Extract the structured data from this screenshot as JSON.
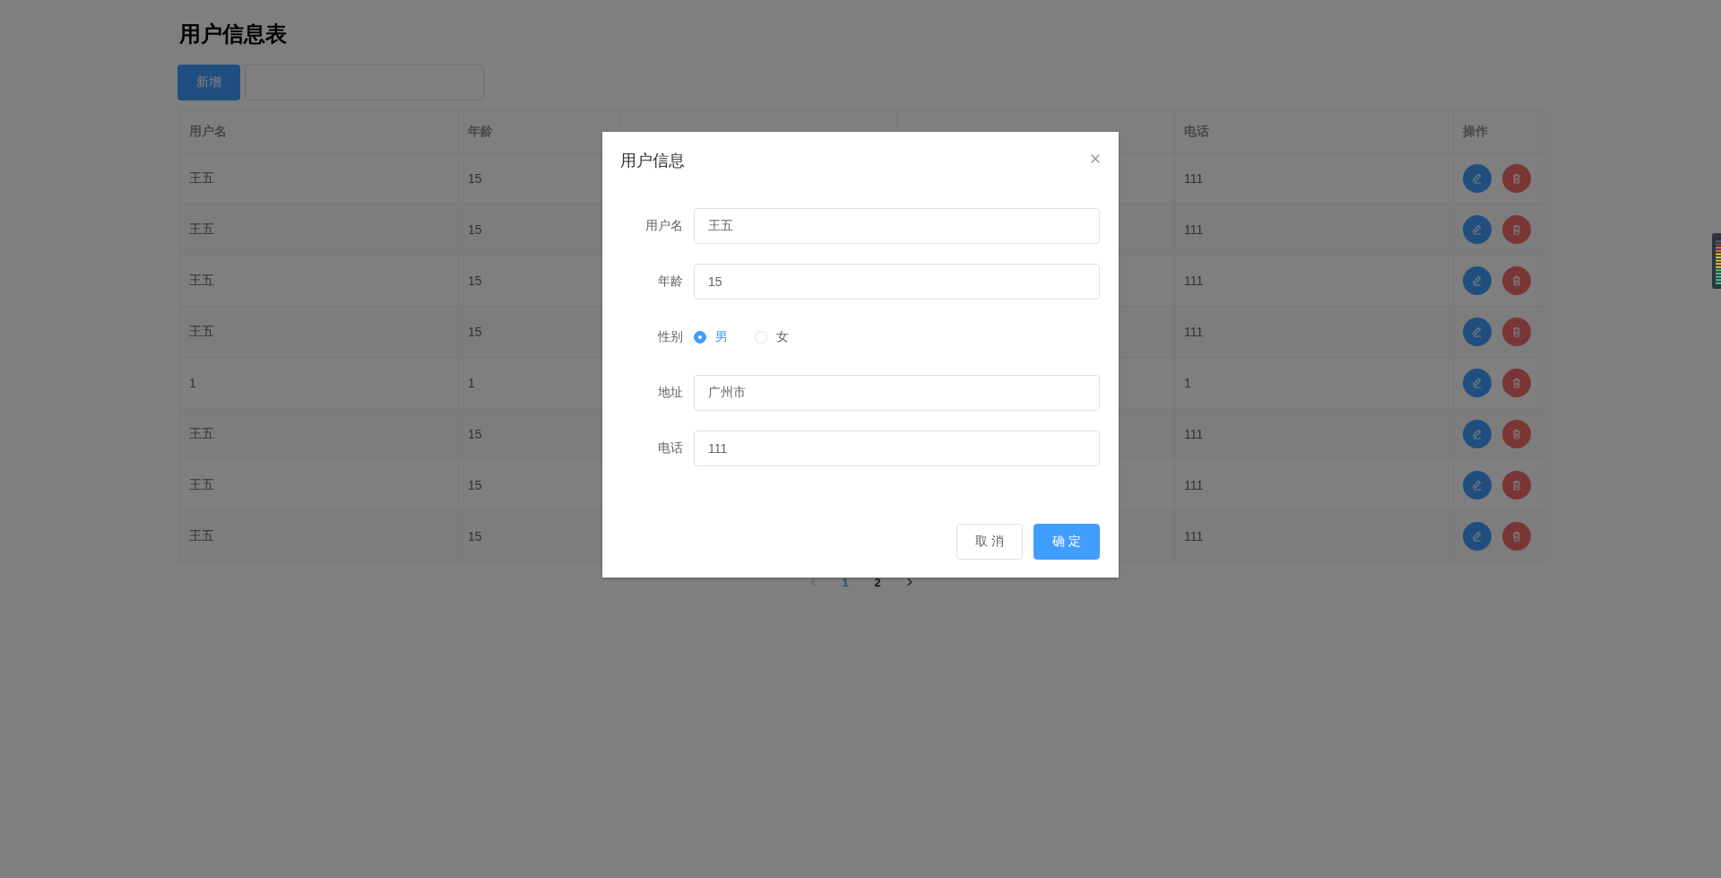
{
  "page_title": "用户信息表",
  "toolbar": {
    "add_button": "新增"
  },
  "table": {
    "columns": [
      "用户名",
      "年龄",
      "电话",
      "操作"
    ],
    "rows": [
      {
        "name": "王五",
        "age": "15",
        "phone": "111"
      },
      {
        "name": "王五",
        "age": "15",
        "phone": "111"
      },
      {
        "name": "王五",
        "age": "15",
        "phone": "111"
      },
      {
        "name": "王五",
        "age": "15",
        "phone": "111"
      },
      {
        "name": "1",
        "age": "1",
        "phone": "1"
      },
      {
        "name": "王五",
        "age": "15",
        "phone": "111"
      },
      {
        "name": "王五",
        "age": "15",
        "phone": "111"
      },
      {
        "name": "王五",
        "age": "15",
        "phone": "111"
      }
    ]
  },
  "pagination": {
    "prev_disabled": true,
    "next_disabled": false,
    "pages": [
      {
        "label": "1",
        "selected": true
      },
      {
        "label": "2",
        "selected": false
      }
    ]
  },
  "dialog": {
    "title": "用户信息",
    "fields": [
      {
        "kind": "text",
        "label": "用户名",
        "value": "王五"
      },
      {
        "kind": "text",
        "label": "年龄",
        "value": "15"
      },
      {
        "kind": "radio",
        "label": "性别",
        "options": [
          {
            "label": "男",
            "selected": true
          },
          {
            "label": "女",
            "selected": false
          }
        ]
      },
      {
        "kind": "text",
        "label": "地址",
        "value": "广州市"
      },
      {
        "kind": "text",
        "label": "电话",
        "value": "111"
      }
    ],
    "cancel_button": "取 消",
    "confirm_button": "确 定"
  }
}
